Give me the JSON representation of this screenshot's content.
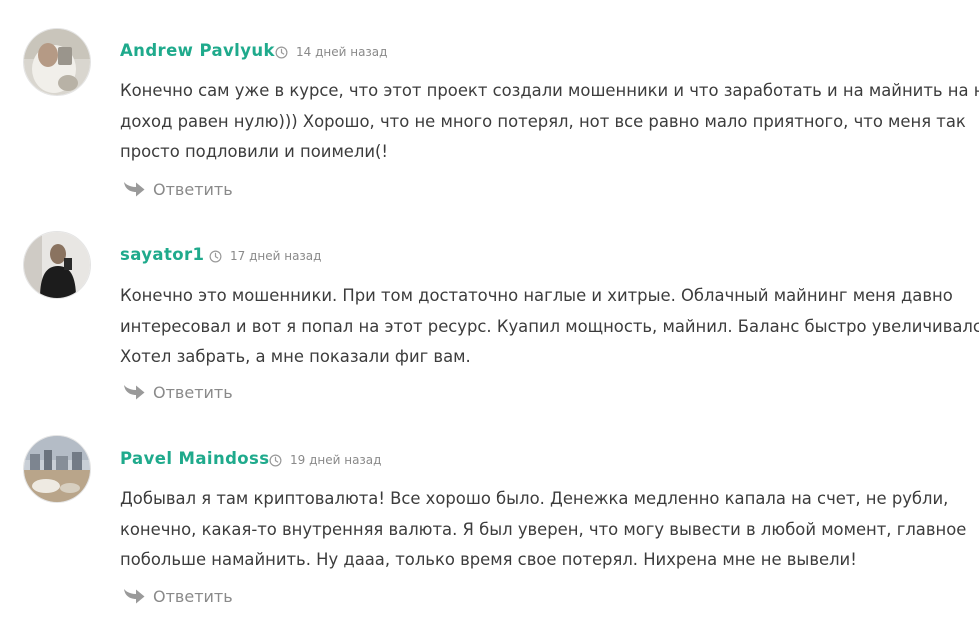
{
  "colors": {
    "author": "#1faa8c",
    "text": "#3c3c3c",
    "muted": "#8a8a8a"
  },
  "comments": [
    {
      "author": "Andrew Pavlyuk",
      "time": "14 дней назад",
      "lines": [
        "Конечно сам уже в курсе, что этот проект создали мошенники и что заработать и на майнить на нем",
        "доход равен нулю))) Хорошо, что не много потерял, нот все равно мало приятного, что меня так",
        "просто подловили и поимели(!"
      ],
      "reply": "Ответить",
      "avatar_icon": "person-photo-avatar"
    },
    {
      "author": "sayator1",
      "time": "17 дней назад",
      "lines": [
        "Конечно это мошенники. При том достаточно наглые и хитрые. Облачный майнинг меня давно",
        "интересовал и вот я попал на этот ресурс. Куапил мощность, майнил. Баланс быстро увеличивался.",
        "Хотел забрать, а мне показали фиг вам."
      ],
      "reply": "Ответить",
      "avatar_icon": "person-photo-avatar"
    },
    {
      "author": "Pavel Maindoss",
      "time": "19 дней назад",
      "lines": [
        "Добывал я там криптовалюта! Все хорошо было. Денежка медленно капала на счет, не рубли,",
        "конечно, какая-то внутренняя валюта. Я был уверен, что могу вывести в любой момент, главное",
        "побольше намайнить. Ну дааа, только время свое потерял. Нихрена мне не вывели!"
      ],
      "reply": "Ответить",
      "avatar_icon": "city-photo-avatar"
    }
  ]
}
